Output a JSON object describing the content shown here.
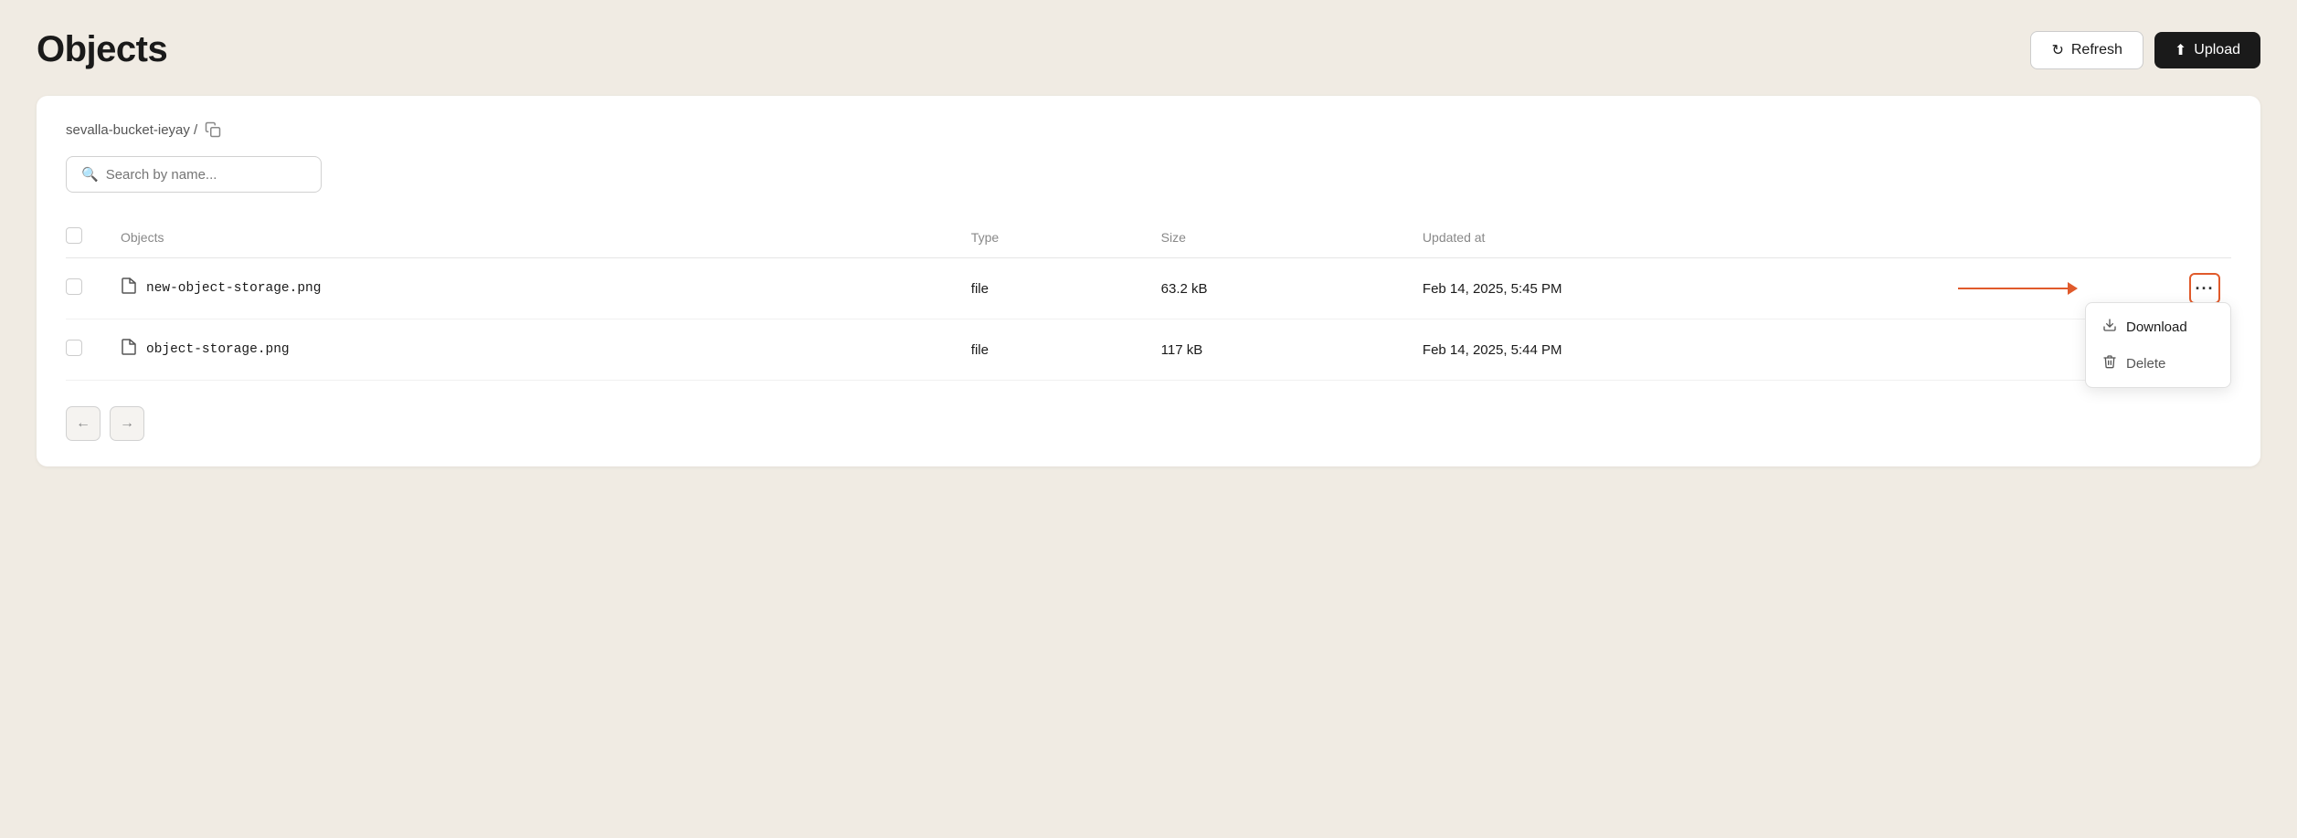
{
  "page": {
    "title": "Objects"
  },
  "header": {
    "refresh_label": "Refresh",
    "upload_label": "Upload"
  },
  "breadcrumb": {
    "path": "sevalla-bucket-ieyay /"
  },
  "search": {
    "placeholder": "Search by name..."
  },
  "table": {
    "columns": [
      "Objects",
      "Type",
      "Size",
      "Updated at"
    ],
    "rows": [
      {
        "name": "new-object-storage.png",
        "type": "file",
        "size": "63.2 kB",
        "updated_at": "Feb 14, 2025, 5:45 PM",
        "has_menu_open": true
      },
      {
        "name": "object-storage.png",
        "type": "file",
        "size": "117 kB",
        "updated_at": "Feb 14, 2025, 5:44 PM",
        "has_menu_open": false
      }
    ]
  },
  "dropdown": {
    "download_label": "Download",
    "delete_label": "Delete"
  },
  "pagination": {
    "prev_label": "←",
    "next_label": "→"
  }
}
